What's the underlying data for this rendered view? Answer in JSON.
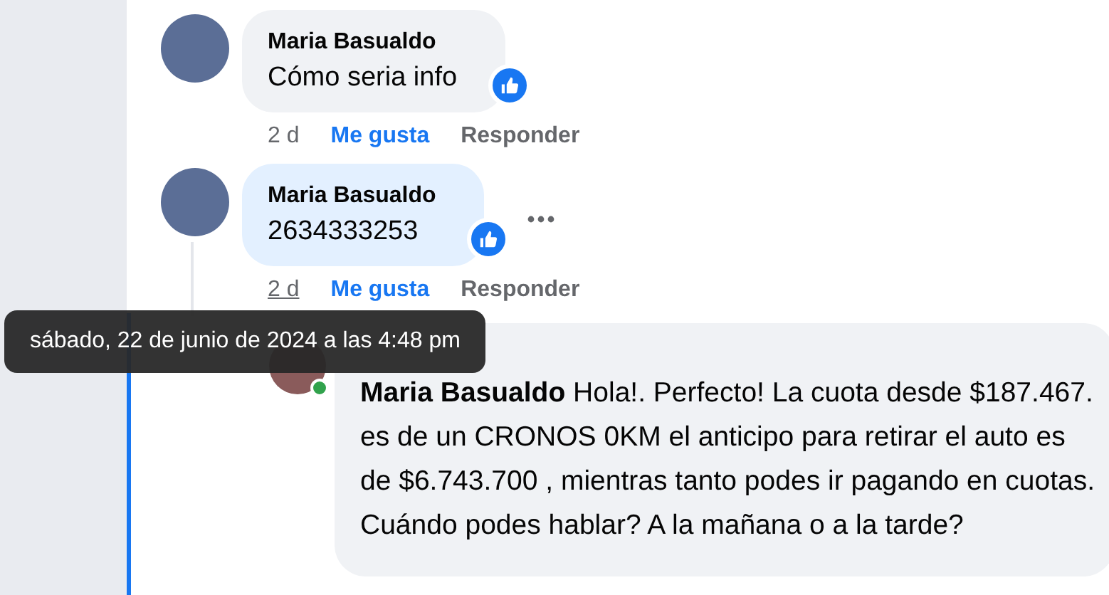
{
  "comments": [
    {
      "author": "Maria Basualdo",
      "text": "Cómo seria info",
      "like_badge": true,
      "highlighted": false,
      "menu": false,
      "time": "2 d",
      "time_hovered": false,
      "liked": true,
      "actions": [
        "Me gusta",
        "Responder"
      ]
    },
    {
      "author": "Maria Basualdo",
      "text": "2634333253",
      "like_badge": true,
      "highlighted": true,
      "menu": true,
      "time": "2 d",
      "time_hovered": true,
      "liked": true,
      "actions": [
        "Me gusta",
        "Responder"
      ]
    }
  ],
  "reply": {
    "mention": "Maria Basualdo",
    "text": "Hola!. Perfecto! La cuota desde $187.467. es de un CRONOS 0KM el anticipo para retirar el auto es de $6.743.700 , mientras tanto podes ir pagando en cuotas. Cuándo podes hablar? A la mañana o a la tarde?",
    "online": true
  },
  "tooltip": {
    "text": "sábado, 22 de junio de 2024 a las 4:48 pm"
  }
}
